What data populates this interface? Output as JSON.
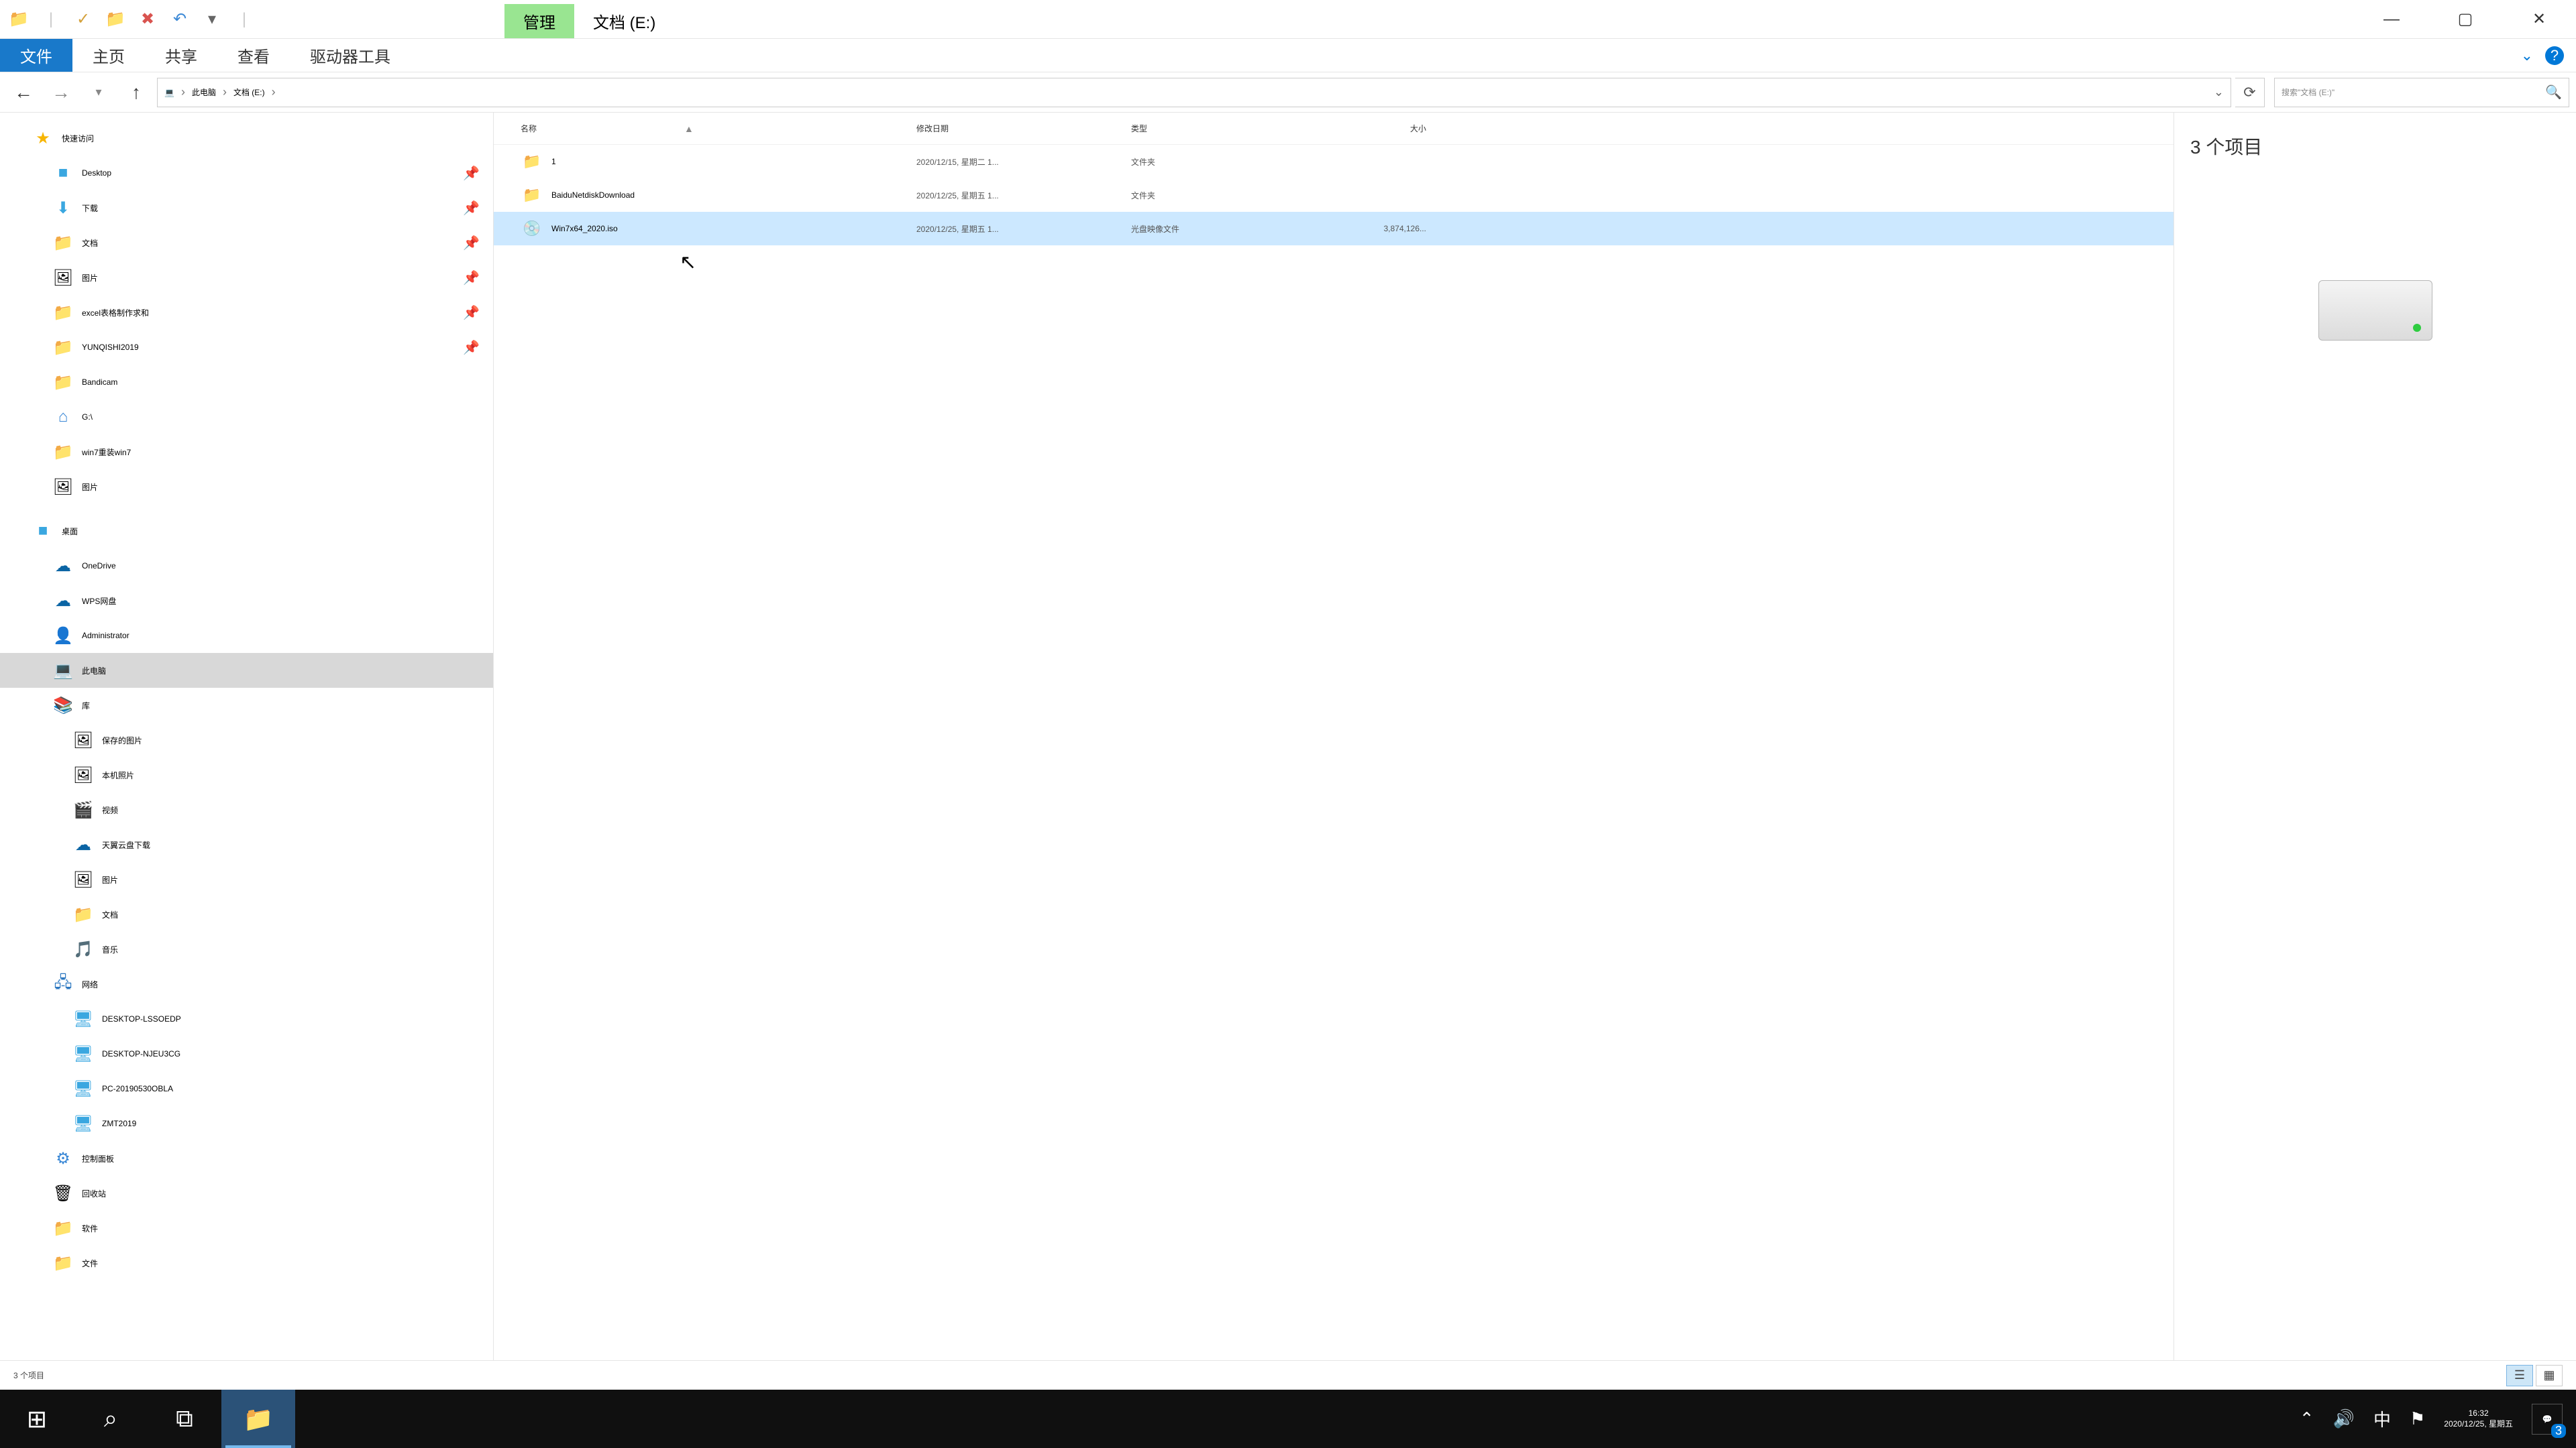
{
  "title_context_tab": "管理",
  "title_location": "文档 (E:)",
  "ribbon": {
    "file": "文件",
    "home": "主页",
    "share": "共享",
    "view": "查看",
    "drive": "驱动器工具"
  },
  "breadcrumb": [
    "此电脑",
    "文档 (E:)"
  ],
  "search_placeholder": "搜索\"文档 (E:)\"",
  "columns": {
    "name": "名称",
    "date": "修改日期",
    "type": "类型",
    "size": "大小"
  },
  "files": [
    {
      "icon": "ic-fold",
      "name": "1",
      "date": "2020/12/15, 星期二 1...",
      "type": "文件夹",
      "size": "",
      "selected": false
    },
    {
      "icon": "ic-fold",
      "name": "BaiduNetdiskDownload",
      "date": "2020/12/25, 星期五 1...",
      "type": "文件夹",
      "size": "",
      "selected": false
    },
    {
      "icon": "ic-iso",
      "name": "Win7x64_2020.iso",
      "date": "2020/12/25, 星期五 1...",
      "type": "光盘映像文件",
      "size": "3,874,126...",
      "selected": true
    }
  ],
  "preview_count": "3 个项目",
  "status_text": "3 个项目",
  "tree": {
    "quick": {
      "label": "快速访问",
      "items": [
        {
          "icon": "ic-desktop",
          "label": "Desktop",
          "pin": true
        },
        {
          "icon": "ic-dl",
          "label": "下载",
          "pin": true
        },
        {
          "icon": "ic-folder",
          "label": "文档",
          "pin": true
        },
        {
          "icon": "ic-pic",
          "label": "图片",
          "pin": true
        },
        {
          "icon": "ic-folder",
          "label": "excel表格制作求和",
          "pin": true
        },
        {
          "icon": "ic-folder",
          "label": "YUNQISHI2019",
          "pin": true
        },
        {
          "icon": "ic-folder",
          "label": "Bandicam",
          "pin": false
        },
        {
          "icon": "ic-drive",
          "label": "G:\\",
          "pin": false
        },
        {
          "icon": "ic-folder",
          "label": "win7重装win7",
          "pin": false
        },
        {
          "icon": "ic-pic",
          "label": "图片",
          "pin": false
        }
      ]
    },
    "desktop": {
      "label": "桌面",
      "items": [
        {
          "icon": "ic-cloud",
          "label": "OneDrive"
        },
        {
          "icon": "ic-cloud",
          "label": "WPS网盘"
        },
        {
          "icon": "ic-user",
          "label": "Administrator"
        },
        {
          "icon": "ic-pc",
          "label": "此电脑",
          "selected": true
        },
        {
          "icon": "ic-lib",
          "label": "库"
        }
      ]
    },
    "lib_items": [
      {
        "icon": "ic-pic",
        "label": "保存的图片"
      },
      {
        "icon": "ic-pic",
        "label": "本机照片"
      },
      {
        "icon": "ic-vid",
        "label": "视频"
      },
      {
        "icon": "ic-cloud",
        "label": "天翼云盘下载"
      },
      {
        "icon": "ic-pic",
        "label": "图片"
      },
      {
        "icon": "ic-folder",
        "label": "文档"
      },
      {
        "icon": "ic-music",
        "label": "音乐"
      }
    ],
    "network": {
      "label": "网络",
      "items": [
        {
          "icon": "ic-netpc",
          "label": "DESKTOP-LSSOEDP"
        },
        {
          "icon": "ic-netpc",
          "label": "DESKTOP-NJEU3CG"
        },
        {
          "icon": "ic-netpc",
          "label": "PC-20190530OBLA"
        },
        {
          "icon": "ic-netpc",
          "label": "ZMT2019"
        }
      ]
    },
    "extra": [
      {
        "icon": "ic-panel",
        "label": "控制面板"
      },
      {
        "icon": "ic-bin",
        "label": "回收站"
      },
      {
        "icon": "ic-folder",
        "label": "软件"
      },
      {
        "icon": "ic-folder",
        "label": "文件"
      }
    ]
  },
  "taskbar": {
    "time": "16:32",
    "date": "2020/12/25, 星期五",
    "ime": "中",
    "notif_count": "3"
  }
}
